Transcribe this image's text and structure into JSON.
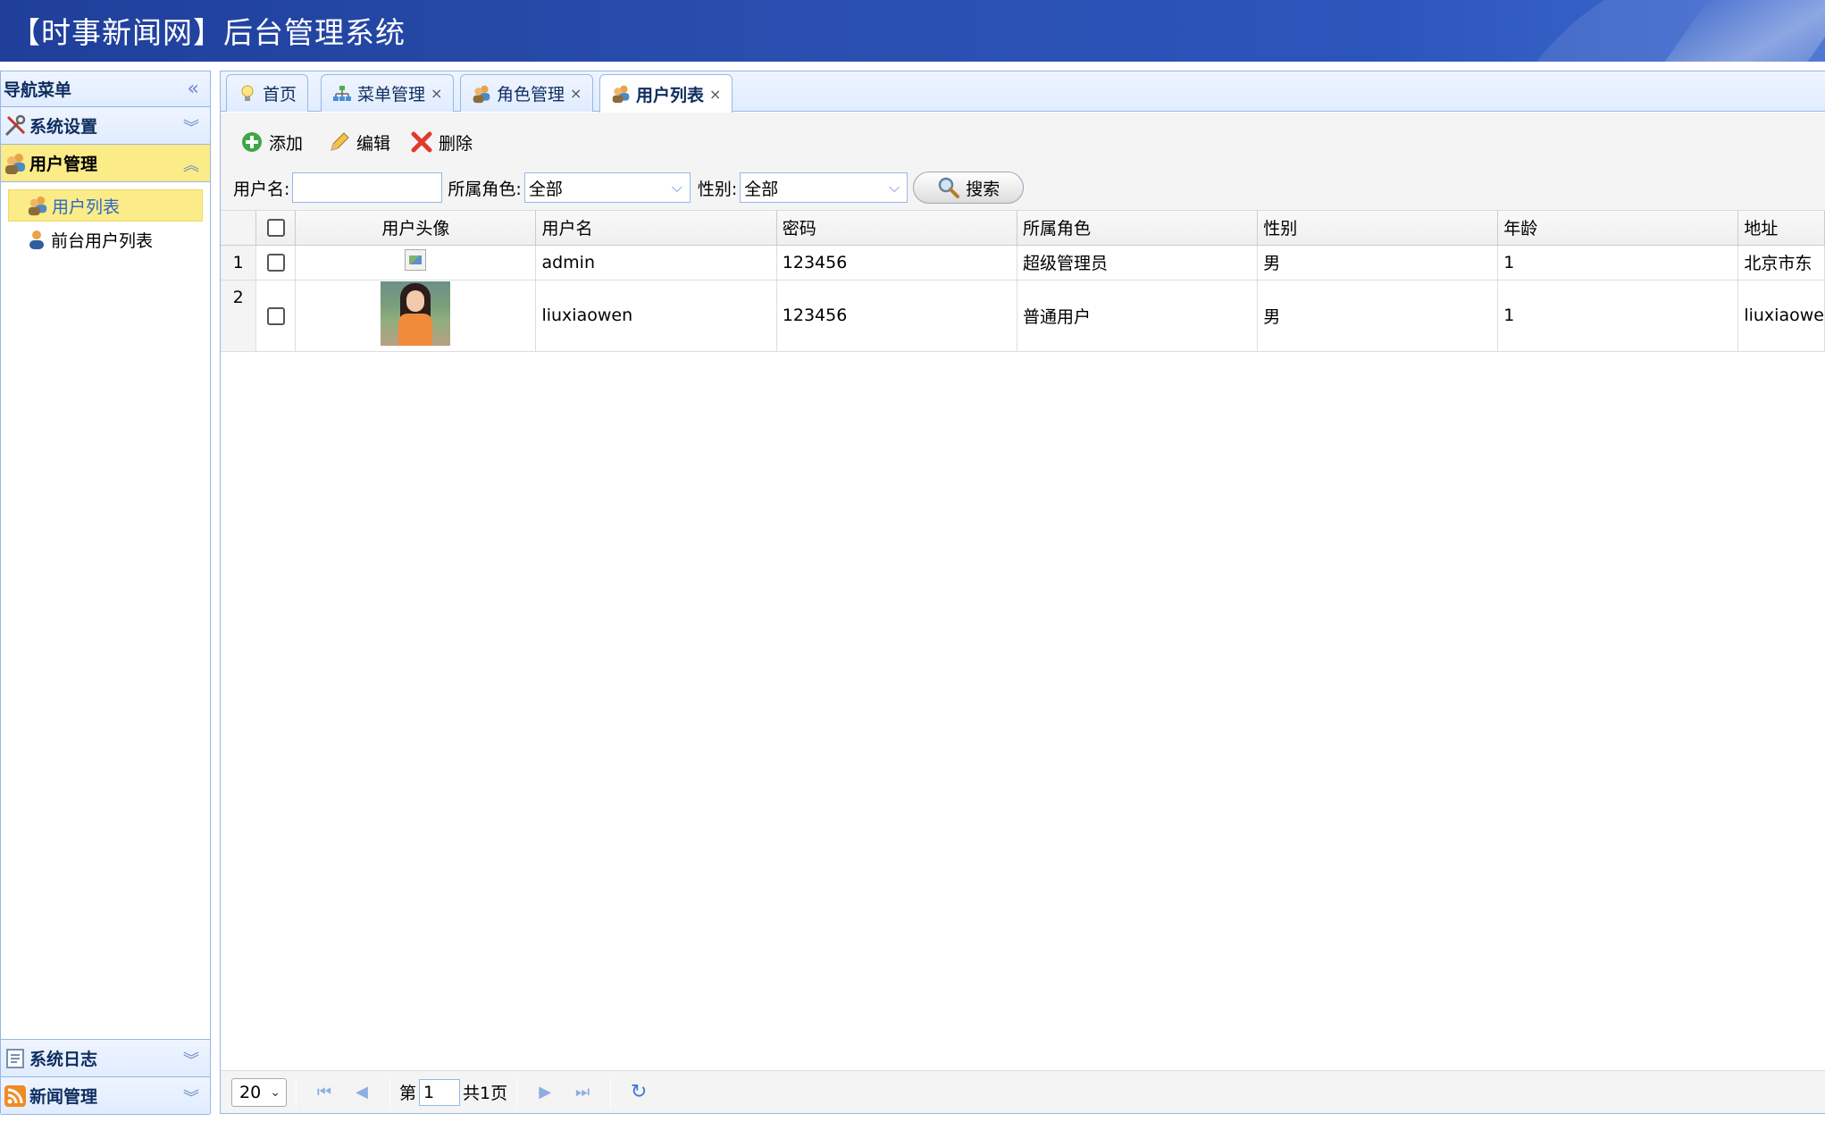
{
  "app": {
    "title": "【时事新闻网】后台管理系统"
  },
  "sidebar": {
    "header": "导航菜单",
    "collapse_icon": "double-chevron-left-icon",
    "sections": [
      {
        "label": "系统设置",
        "icon": "tools-icon",
        "state": "collapsed"
      },
      {
        "label": "用户管理",
        "icon": "users-icon",
        "state": "expanded"
      },
      {
        "label": "系统日志",
        "icon": "log-icon",
        "state": "collapsed"
      },
      {
        "label": "新闻管理",
        "icon": "rss-icon",
        "state": "collapsed"
      }
    ],
    "user_mgmt_items": [
      {
        "label": "用户列表",
        "icon": "users-icon",
        "selected": true
      },
      {
        "label": "前台用户列表",
        "icon": "user-icon",
        "selected": false
      }
    ]
  },
  "tabs": [
    {
      "label": "首页",
      "icon": "lightbulb-icon",
      "closable": false,
      "active": false
    },
    {
      "label": "菜单管理",
      "icon": "sitemap-icon",
      "closable": true,
      "active": false
    },
    {
      "label": "角色管理",
      "icon": "users-icon",
      "closable": true,
      "active": false
    },
    {
      "label": "用户列表",
      "icon": "users-icon",
      "closable": true,
      "active": true
    }
  ],
  "tab_close_glyph": "×",
  "toolbar": {
    "add_label": "添加",
    "edit_label": "编辑",
    "delete_label": "删除"
  },
  "search": {
    "username_label": "用户名:",
    "username_value": "",
    "role_label": "所属角色:",
    "role_value": "全部",
    "gender_label": "性别:",
    "gender_value": "全部",
    "button_label": "搜索"
  },
  "grid": {
    "columns": [
      "用户头像",
      "用户名",
      "密码",
      "所属角色",
      "性别",
      "年龄",
      "地址"
    ],
    "rows": [
      {
        "num": "1",
        "avatar": "broken-image",
        "username": "admin",
        "password": "123456",
        "role": "超级管理员",
        "gender": "男",
        "age": "1",
        "address": "北京市东"
      },
      {
        "num": "2",
        "avatar": "photo",
        "username": "liuxiaowen",
        "password": "123456",
        "role": "普通用户",
        "gender": "男",
        "age": "1",
        "address": "liuxiaowe"
      }
    ]
  },
  "pager": {
    "page_size": "20",
    "page_prefix": "第",
    "page_value": "1",
    "page_total": "共1页"
  },
  "colors": {
    "header_bg": "#2a4fb0",
    "panel_border": "#95b8e7",
    "selected_bg": "#fbec88",
    "selected_text": "#2f66c4"
  }
}
